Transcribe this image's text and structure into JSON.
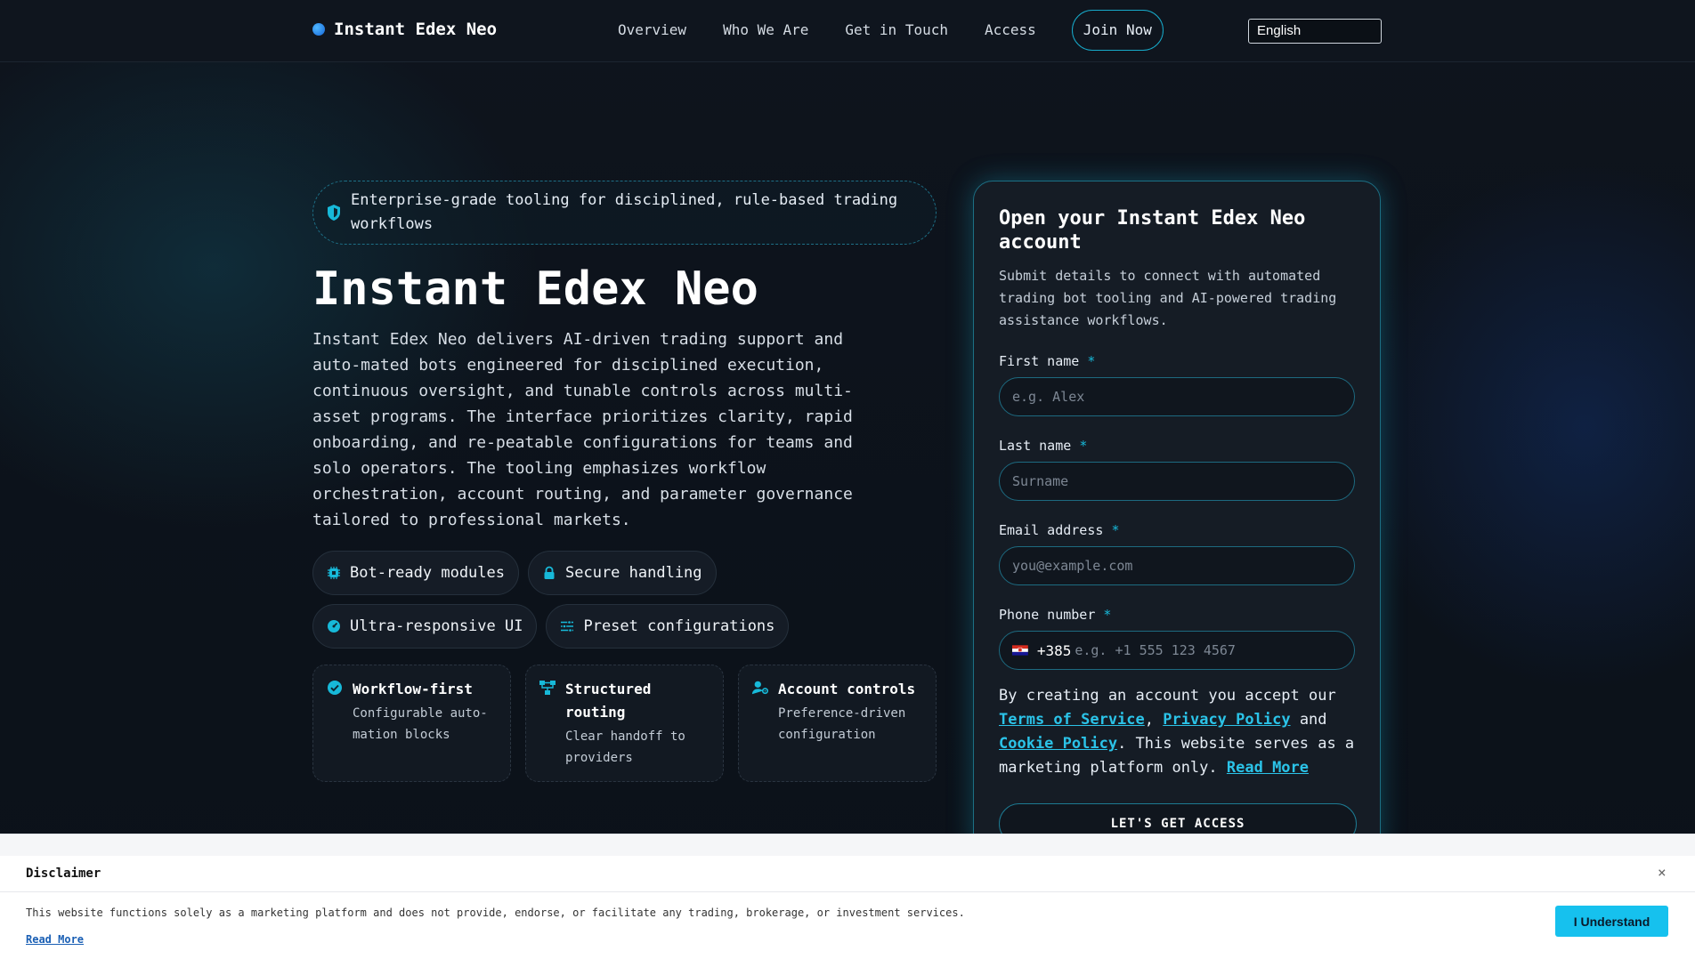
{
  "nav": {
    "brand": "Instant Edex Neo",
    "links": [
      "Overview",
      "Who We Are",
      "Get in Touch",
      "Access"
    ],
    "join": "Join Now",
    "language": "English"
  },
  "hero": {
    "tagline": "Enterprise-grade tooling for disciplined, rule-based trading workflows",
    "title": "Instant Edex Neo",
    "description": "Instant Edex Neo delivers AI-driven trading support and auto-mated bots engineered for disciplined execution, continuous oversight, and tunable controls across multi-asset programs. The interface prioritizes clarity, rapid onboarding, and re-peatable configurations for teams and solo operators. The tooling emphasizes workflow orchestration, account routing, and parameter governance tailored to professional markets.",
    "pills": [
      {
        "label": "Bot-ready modules",
        "icon": "chip-icon"
      },
      {
        "label": "Secure handling",
        "icon": "lock-icon"
      },
      {
        "label": "Ultra-responsive UI",
        "icon": "gauge-icon"
      },
      {
        "label": "Preset configurations",
        "icon": "sliders-icon"
      }
    ],
    "cards": [
      {
        "title": "Workflow-first",
        "sub": "Configurable auto-mation blocks",
        "icon": "check-circle-icon"
      },
      {
        "title": "Structured routing",
        "sub": "Clear handoff to providers",
        "icon": "routing-icon"
      },
      {
        "title": "Account controls",
        "sub": "Preference-driven configuration",
        "icon": "user-gear-icon"
      }
    ]
  },
  "form": {
    "title": "Open your Instant Edex Neo account",
    "description": "Submit details to connect with automated trading bot tooling and AI-powered trading assistance workflows.",
    "first_name": {
      "label": "First name",
      "placeholder": "e.g. Alex"
    },
    "last_name": {
      "label": "Last name",
      "placeholder": "Surname"
    },
    "email": {
      "label": "Email address",
      "placeholder": "you@example.com"
    },
    "phone": {
      "label": "Phone number",
      "dial_code": "+385",
      "placeholder": "e.g. +1 555 123 4567"
    },
    "required_mark": "*",
    "consent": {
      "prefix": "By creating an account you accept our",
      "terms": "Terms of Service",
      "comma": ",",
      "privacy": "Privacy Policy",
      "and": "and",
      "cookie": "Cookie Policy",
      "middle": ". This website serves as a marketing platform only.",
      "read_more": "Read More"
    },
    "submit": "LET'S GET ACCESS"
  },
  "disclaimer": {
    "title": "Disclaimer",
    "close": "×",
    "text": "This website functions solely as a marketing platform and does not provide, endorse, or facilitate any trading, brokerage, or investment services.",
    "read_more": "Read More",
    "button": "I Understand"
  },
  "colors": {
    "accent": "#17b9d9",
    "background": "#0d131c",
    "card": "#151c25",
    "disclaimer_button": "#16c1ee"
  }
}
